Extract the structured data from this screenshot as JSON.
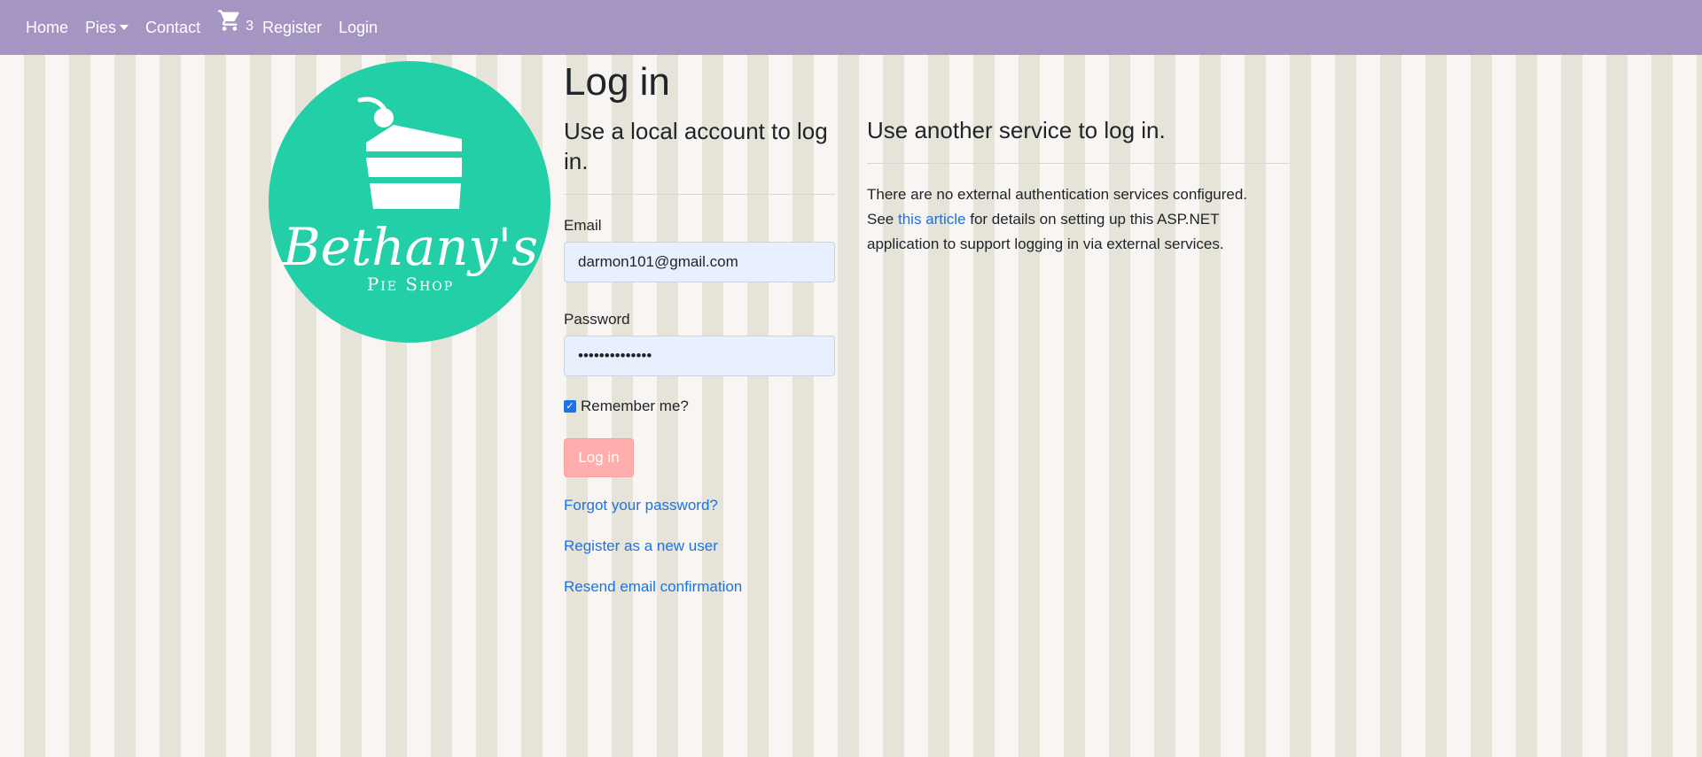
{
  "nav": {
    "home": "Home",
    "pies": "Pies",
    "contact": "Contact",
    "cart_count": "3",
    "register": "Register",
    "login": "Login"
  },
  "logo": {
    "brand": "Bethany's",
    "sub": "Pie Shop",
    "color": "#22cfa6"
  },
  "login": {
    "title": "Log in",
    "local_heading": "Use a local account to log in.",
    "email_label": "Email",
    "email_value": "darmon101@gmail.com",
    "password_label": "Password",
    "password_value": "••••••••••••••",
    "remember_label": "Remember me?",
    "submit_label": "Log in",
    "forgot_link": "Forgot your password?",
    "register_link": "Register as a new user",
    "resend_link": "Resend email confirmation"
  },
  "external": {
    "heading": "Use another service to log in.",
    "text_1": "There are no external authentication services configured.",
    "text_see": "See ",
    "link": "this article",
    "text_2": " for details on setting up this ASP.NET application to support logging in via external services."
  },
  "colors": {
    "navbar": "#a495c3",
    "link": "#1a73e8",
    "button": "#ffadad"
  }
}
